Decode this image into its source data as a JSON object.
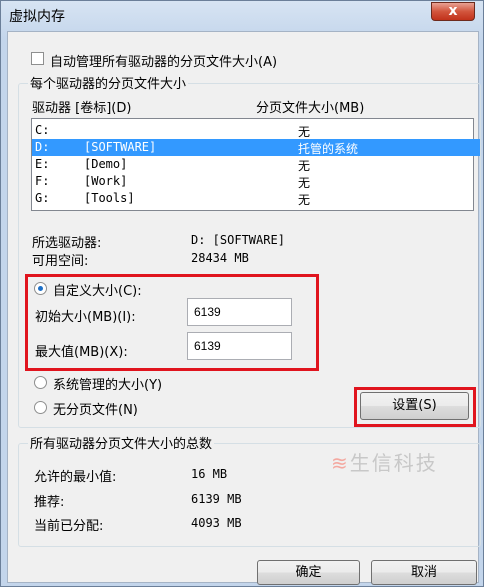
{
  "window": {
    "title": "虚拟内存",
    "close_label": "x"
  },
  "auto_manage": {
    "label": "自动管理所有驱动器的分页文件大小(A)",
    "checked": false
  },
  "per_drive_group": {
    "legend": "每个驱动器的分页文件大小",
    "col_drive": "驱动器 [卷标](D)",
    "col_size": "分页文件大小(MB)"
  },
  "drives": [
    {
      "letter": "C:",
      "label": "",
      "size": "无",
      "selected": false
    },
    {
      "letter": "D:",
      "label": "[SOFTWARE]",
      "size": "托管的系统",
      "selected": true
    },
    {
      "letter": "E:",
      "label": "[Demo]",
      "size": "无",
      "selected": false
    },
    {
      "letter": "F:",
      "label": "[Work]",
      "size": "无",
      "selected": false
    },
    {
      "letter": "G:",
      "label": "[Tools]",
      "size": "无",
      "selected": false
    }
  ],
  "selected_drive": {
    "label": "所选驱动器:",
    "value": "D:  [SOFTWARE]",
    "free_label": "可用空间:",
    "free_value": "28434 MB"
  },
  "options": {
    "custom_label": "自定义大小(C):",
    "initial_label": "初始大小(MB)(I):",
    "initial_value": "6139",
    "max_label": "最大值(MB)(X):",
    "max_value": "6139",
    "system_label": "系统管理的大小(Y)",
    "none_label": "无分页文件(N)",
    "selected": "custom"
  },
  "set_button": "设置(S)",
  "totals_group": {
    "legend": "所有驱动器分页文件大小的总数",
    "min_label": "允许的最小值:",
    "min_value": "16 MB",
    "rec_label": "推荐:",
    "rec_value": "6139 MB",
    "cur_label": "当前已分配:",
    "cur_value": "4093 MB"
  },
  "watermark": "生信科技",
  "buttons": {
    "ok": "确定",
    "cancel": "取消"
  },
  "colors": {
    "selection": "#3399ff",
    "highlight_box": "#e0141e"
  }
}
